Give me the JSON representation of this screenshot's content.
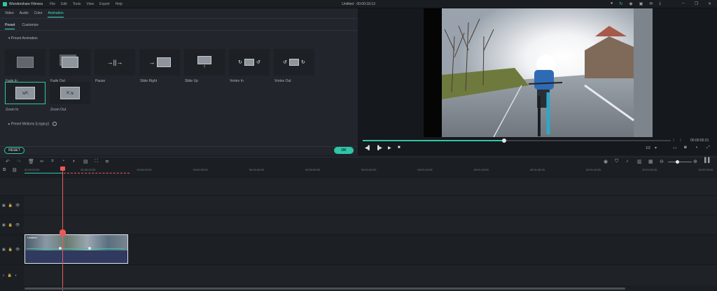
{
  "titlebar": {
    "app_name": "Wondershare Filmora",
    "menu": [
      "File",
      "Edit",
      "Tools",
      "View",
      "Export",
      "Help"
    ],
    "window_title": "Untitled : 00:00:18:13",
    "window_controls": [
      "minimize-icon",
      "maximize-icon",
      "close-icon"
    ]
  },
  "panel": {
    "tabs": [
      {
        "label": "Video",
        "active": false
      },
      {
        "label": "Audio",
        "active": false
      },
      {
        "label": "Color",
        "active": false
      },
      {
        "label": "Animation",
        "active": true
      }
    ],
    "subtabs": [
      {
        "label": "Preset",
        "active": true
      },
      {
        "label": "Customize",
        "active": false
      }
    ],
    "preset_section": "Preset Animation",
    "presets": [
      {
        "label": "Fade In",
        "icon": "fade-in-icon",
        "selected": false
      },
      {
        "label": "Fade Out",
        "icon": "fade-out-icon",
        "selected": false
      },
      {
        "label": "Pause",
        "icon": "pause-anim-icon",
        "selected": false
      },
      {
        "label": "Slide Right",
        "icon": "slide-right-icon",
        "selected": false
      },
      {
        "label": "Slide Up",
        "icon": "slide-up-icon",
        "selected": false
      },
      {
        "label": "Vortex In",
        "icon": "vortex-in-icon",
        "selected": false
      },
      {
        "label": "Vortex Out",
        "icon": "vortex-out-icon",
        "selected": false
      },
      {
        "label": "Zoom In",
        "icon": "zoom-in-anim-icon",
        "selected": true
      },
      {
        "label": "Zoom Out",
        "icon": "zoom-out-anim-icon",
        "selected": false
      }
    ],
    "legacy_section": "Preset Motions (Legacy)",
    "reset_label": "RESET",
    "ok_label": "OK"
  },
  "preview": {
    "progress": 0.46,
    "time": "00:00:00:21",
    "ratio": "1/2"
  },
  "ruler": {
    "ticks": [
      "00:00:00:00",
      "00:00:10:00",
      "00:00:20:00",
      "00:00:30:00",
      "00:00:40:00",
      "00:00:50:00",
      "00:01:00:00",
      "00:01:10:00",
      "00:01:20:00",
      "00:01:30:00",
      "00:01:40:00",
      "00:01:50:00",
      "00:02:00:00"
    ]
  },
  "clip": {
    "label": "Untitled"
  },
  "colors": {
    "accent": "#2fc6a8",
    "playhead": "#e85a5a"
  }
}
